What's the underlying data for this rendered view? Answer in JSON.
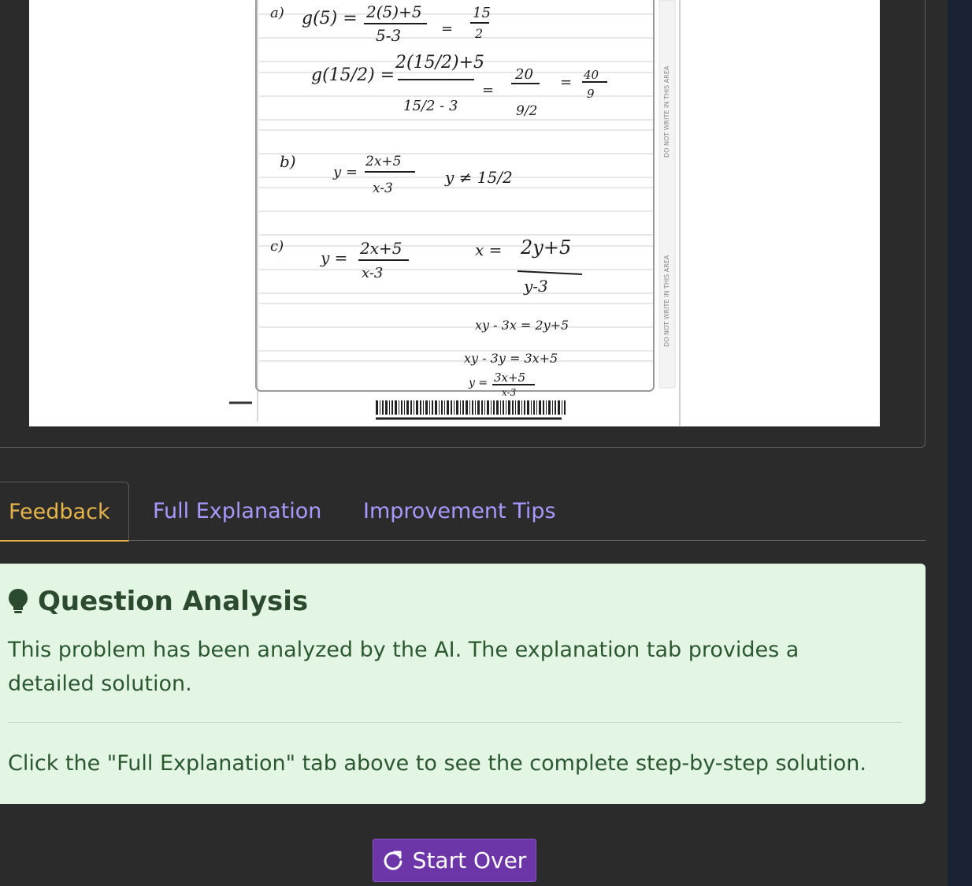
{
  "tabs": {
    "feedback": "Feedback",
    "full_explanation": "Full Explanation",
    "improvement_tips": "Improvement Tips"
  },
  "feedback_panel": {
    "title": "Question Analysis",
    "text": "This problem has been analyzed by the AI. The explanation tab provides a detailed solution.",
    "hint": "Click the \"Full Explanation\" tab above to see the complete step-by-step solution."
  },
  "actions": {
    "start_over": "Start Over"
  },
  "scan": {
    "margin_note": "DO NOT WRITE IN THIS AREA",
    "work": {
      "a_label": "a)",
      "a_line1_lhs": "g(5) =",
      "a_line1_num": "2(5)+5",
      "a_line1_den": "5-3",
      "a_line1_eq": "=",
      "a_line1_rnum": "15",
      "a_line1_rden": "2",
      "a_line2_lhs": "g(15/2) =",
      "a_line2_num": "2(15/2)+5",
      "a_line2_den": "15/2 - 3",
      "a_line2_eq": "=",
      "a_line2_mid_num": "20",
      "a_line2_mid_den": "9/2",
      "a_line2_eq2": "=",
      "a_line2_rnum": "40",
      "a_line2_rden": "9",
      "b_label": "b)",
      "b_lhs": "y =",
      "b_num": "2x+5",
      "b_den": "x-3",
      "b_cond": "y ≠ 15/2",
      "c_label": "c)",
      "c_lhs": "y =",
      "c_num": "2x+5",
      "c_den": "x-3",
      "c_swap_lhs": "x =",
      "c_swap_num": "2y+5",
      "c_swap_den": "y-3",
      "c_step1": "xy - 3x = 2y+5",
      "c_step2": "xy - 3y = 3x+5",
      "c_step3_lhs": "y =",
      "c_step3_num": "3x+5",
      "c_step3_den": "x-3"
    }
  }
}
